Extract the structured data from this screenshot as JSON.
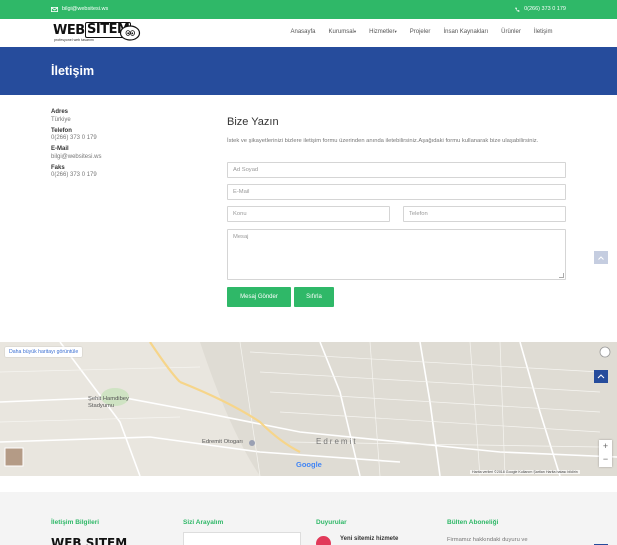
{
  "topbar": {
    "email": "bilgi@websitesi.ws",
    "phone": "0(266) 373 0 179",
    "bg_color": "#2fb868"
  },
  "logo": {
    "word1": "WEB",
    "word2": "SITEM",
    "tagline": "profesyonel web tasarımı"
  },
  "nav": [
    {
      "label": "Anasayfa",
      "dropdown": false
    },
    {
      "label": "Kurumsal",
      "dropdown": true
    },
    {
      "label": "Hizmetler",
      "dropdown": true
    },
    {
      "label": "Projeler",
      "dropdown": false
    },
    {
      "label": "İnsan Kaynakları",
      "dropdown": false
    },
    {
      "label": "Ürünler",
      "dropdown": false
    },
    {
      "label": "İletişim",
      "dropdown": false
    }
  ],
  "page_title": "İletişim",
  "title_band_color": "#264c9c",
  "contact": {
    "address_label": "Adres",
    "address_value": "Türkiye",
    "phone_label": "Telefon",
    "phone_value": "0(266) 373 0 179",
    "email_label": "E-Mail",
    "email_value": "bilgi@websitesi.ws",
    "fax_label": "Faks",
    "fax_value": "0(266) 373 0 179"
  },
  "form": {
    "title": "Bize Yazın",
    "description": "İstek ve şikayetlerinizi bizlere iletişim formu üzerinden anında iletebilirsiniz.Aşağıdaki formu kullanarak bize ulaşabilirsiniz.",
    "name_placeholder": "Ad Soyad",
    "email_placeholder": "E-Mail",
    "subject_placeholder": "Konu",
    "phone_placeholder": "Telefon",
    "message_placeholder": "Mesaj",
    "send_label": "Mesaj Gönder",
    "reset_label": "Sıfırla"
  },
  "map": {
    "bigger_map_link": "Daha büyük haritayı görüntüle",
    "labels": {
      "stadium": "Şehit Hamdibey Stadyumu",
      "bus_station": "Edremit Otogarı",
      "town": "Edremit"
    },
    "google": "Google",
    "credits": "Harita verileri ©2018 Google   Kullanım Şartları   Harita hatası bildirin",
    "zoom_in": "+",
    "zoom_out": "−"
  },
  "footer": {
    "col1_title": "İletişim Bilgileri",
    "col2_title": "Sizi Arayalım",
    "col3_title": "Duyurular",
    "col4_title": "Bülten Aboneliği",
    "news_item": "Yeni sitemiz hizmete",
    "bulten_text": "Firmamız hakkındaki duyuru ve",
    "logo_text": "WEB SITEM",
    "accent_color": "#2fb868"
  }
}
